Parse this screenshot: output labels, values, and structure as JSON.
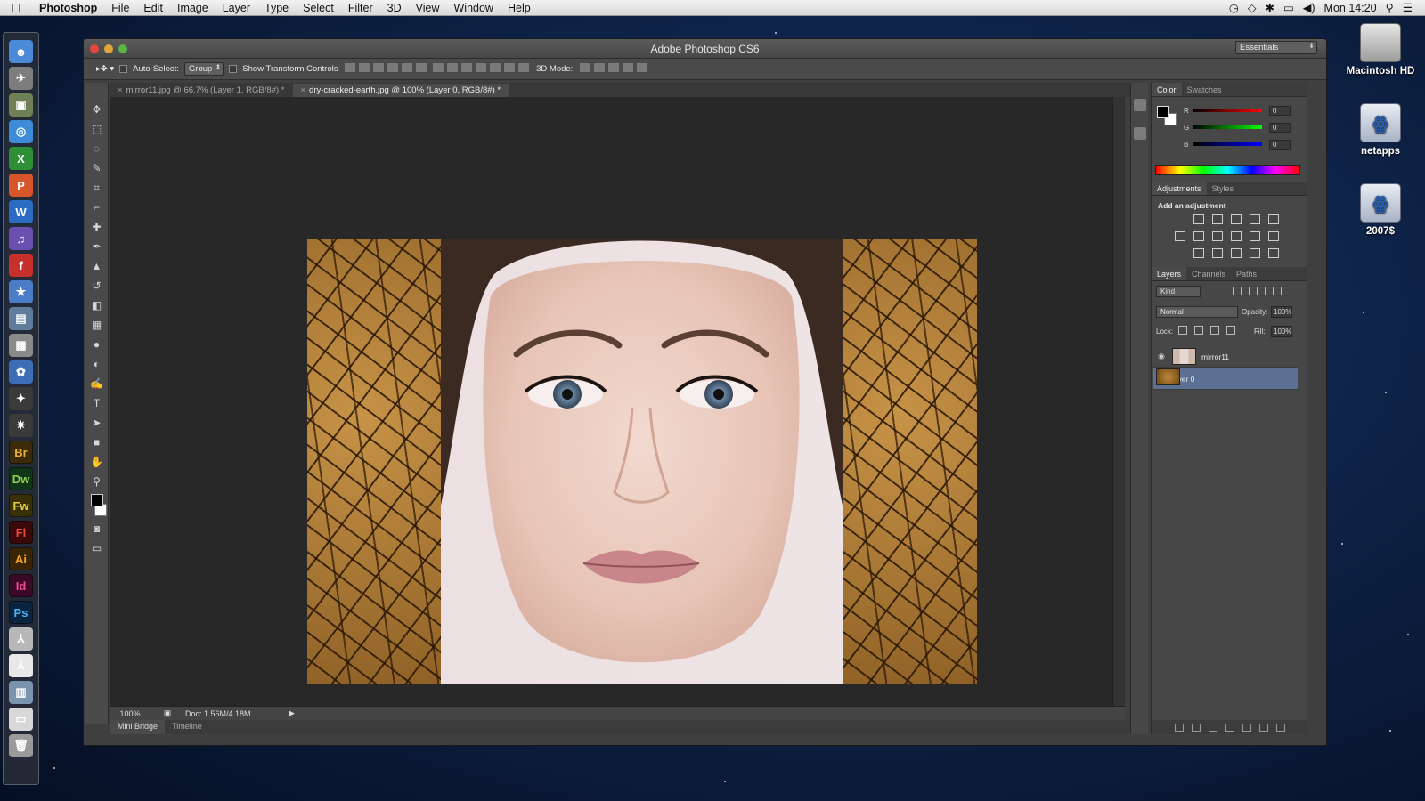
{
  "menubar": {
    "app_name": "Photoshop",
    "items": [
      "File",
      "Edit",
      "Image",
      "Layer",
      "Type",
      "Select",
      "Filter",
      "3D",
      "View",
      "Window",
      "Help"
    ],
    "clock": "Mon 14:20",
    "status_icons": [
      "time-machine-icon",
      "wifi-icon",
      "bluetooth-icon",
      "display-icon",
      "volume-icon",
      "spotlight-icon",
      "list-icon"
    ]
  },
  "desktop": {
    "icons": [
      {
        "label": "Macintosh HD",
        "kind": "hard-drive"
      },
      {
        "label": "netapps",
        "kind": "network-share"
      },
      {
        "label": "2007$",
        "kind": "network-share"
      }
    ]
  },
  "dock": {
    "apps": [
      {
        "name": "finder-icon",
        "glyph": "☻",
        "color": "#4a8ad8"
      },
      {
        "name": "launchpad-icon",
        "glyph": "✈",
        "color": "#7d7d7d"
      },
      {
        "name": "image-capture-icon",
        "glyph": "▣",
        "color": "#6f7f56"
      },
      {
        "name": "safari-icon",
        "glyph": "◎",
        "color": "#3d8bd8"
      },
      {
        "name": "excel-icon",
        "glyph": "X",
        "color": "#2f8f37"
      },
      {
        "name": "powerpoint-icon",
        "glyph": "P",
        "color": "#d6562a"
      },
      {
        "name": "word-icon",
        "glyph": "W",
        "color": "#2a6cc4"
      },
      {
        "name": "itunes-icon",
        "glyph": "♫",
        "color": "#6a4fb0"
      },
      {
        "name": "flash-icon",
        "glyph": "f",
        "color": "#c8312b"
      },
      {
        "name": "imovie-icon",
        "glyph": "★",
        "color": "#4a7cc8"
      },
      {
        "name": "preview-icon",
        "glyph": "▤",
        "color": "#5f7c9c"
      },
      {
        "name": "photo-booth-icon",
        "glyph": "▦",
        "color": "#8a8a8a"
      },
      {
        "name": "iphoto-icon",
        "glyph": "✿",
        "color": "#3d6db6"
      },
      {
        "name": "network-icon",
        "glyph": "✦",
        "color": "#3a3a3a"
      },
      {
        "name": "cluster-icon",
        "glyph": "✷",
        "color": "#3a3a3a"
      },
      {
        "name": "bridge-icon",
        "glyph": "Br",
        "color": "#3b2b0a",
        "text_color": "#e8b23a"
      },
      {
        "name": "dreamweaver-icon",
        "glyph": "Dw",
        "color": "#10361a",
        "text_color": "#8fd14f"
      },
      {
        "name": "fireworks-icon",
        "glyph": "Fw",
        "color": "#3a3008",
        "text_color": "#e8d23a"
      },
      {
        "name": "flash-pro-icon",
        "glyph": "Fl",
        "color": "#3a0a0a",
        "text_color": "#f04b3a"
      },
      {
        "name": "illustrator-icon",
        "glyph": "Ai",
        "color": "#3a2406",
        "text_color": "#f5a623"
      },
      {
        "name": "indesign-icon",
        "glyph": "Id",
        "color": "#3a0a26",
        "text_color": "#f04b9a"
      },
      {
        "name": "photoshop-icon",
        "glyph": "Ps",
        "color": "#0a2440",
        "text_color": "#4fb0f0"
      },
      {
        "name": "acrobat-icon",
        "glyph": "⅄",
        "color": "#b8b8b8"
      },
      {
        "name": "acrobat-reader-icon",
        "glyph": "⅄",
        "color": "#e8e8e8"
      },
      {
        "name": "system-preferences-icon",
        "glyph": "▥",
        "color": "#7a94b0"
      },
      {
        "name": "document-icon",
        "glyph": "▭",
        "color": "#d8d8d8"
      },
      {
        "name": "trash-icon",
        "glyph": "🗑",
        "color": "#9a9a9a"
      }
    ]
  },
  "window": {
    "title": "Adobe Photoshop CS6",
    "options": {
      "auto_select_label": "Auto-Select:",
      "auto_select_value": "Group",
      "transform_label": "Show Transform Controls",
      "mode_label": "3D Mode:",
      "workspace": "Essentials"
    },
    "tabs": [
      {
        "label": "mirror11.jpg @ 66.7% (Layer 1, RGB/8#) *",
        "active": false
      },
      {
        "label": "dry-cracked-earth.jpg @ 100% (Layer 0, RGB/8#) *",
        "active": true
      }
    ],
    "tools": [
      "move",
      "marquee",
      "lasso",
      "quick-select",
      "crop",
      "eyedropper",
      "healing",
      "brush",
      "stamp",
      "history-brush",
      "eraser",
      "gradient",
      "blur",
      "dodge",
      "pen",
      "type",
      "path-select",
      "shape",
      "hand",
      "zoom"
    ],
    "status": {
      "zoom": "100%",
      "doc": "Doc: 1.56M/4.18M"
    },
    "bottom_tabs": [
      "Mini Bridge",
      "Timeline"
    ]
  },
  "panels": {
    "color": {
      "tabs": [
        "Color",
        "Swatches"
      ],
      "r": "0",
      "g": "0",
      "b": "0",
      "r_label": "R",
      "g_label": "G",
      "b_label": "B"
    },
    "adjustments": {
      "tabs": [
        "Adjustments",
        "Styles"
      ],
      "title": "Add an adjustment"
    },
    "layers": {
      "tabs": [
        "Layers",
        "Channels",
        "Paths"
      ],
      "filter": "Kind",
      "blend_mode": "Normal",
      "opacity_label": "Opacity:",
      "opacity": "100%",
      "lock_label": "Lock:",
      "fill_label": "Fill:",
      "fill": "100%",
      "items": [
        {
          "name": "mirror11",
          "selected": false
        },
        {
          "name": "Layer 0",
          "selected": true
        }
      ]
    }
  },
  "colors": {
    "selection": "#5b7092",
    "accent_red": "#e2463f"
  }
}
